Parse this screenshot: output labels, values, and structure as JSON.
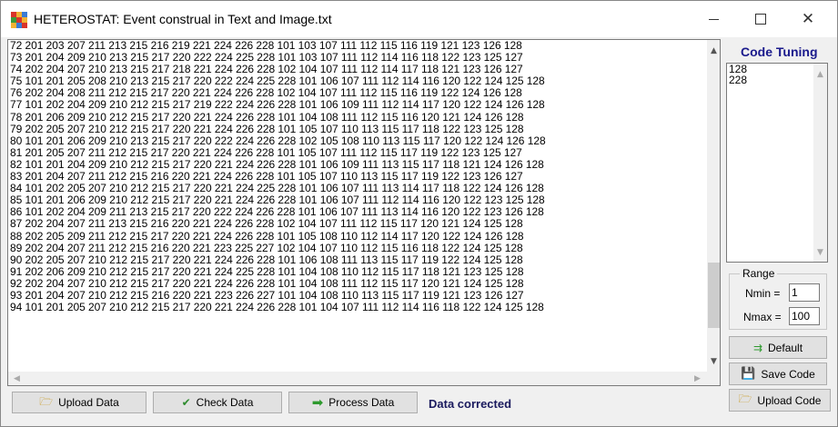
{
  "window": {
    "title": "HETEROSTAT: Event construal in Text and Image.txt",
    "icon": "heterostat-app-icon",
    "controls": [
      "minimize-icon",
      "maximize-icon",
      "close-icon"
    ]
  },
  "text_lines": [
    "72 201 203 207 211 213 215 216 219 221 224 226 228 101 103 107 111 112 115 116 119 121 123 126 128",
    "73 201 204 209 210 213 215 217 220 222 224 225 228 101 103 107 111 112 114 116 118 122 123 125 127",
    "74 202 204 207 210 213 215 217 218 221 224 226 228 102 104 107 111 112 114 117 118 121 123 126 127",
    "75 101 201 205 208 210 213 215 217 220 222 224 225 228 101 106 107 111 112 114 116 120 122 124 125 128",
    "76 202 204 208 211 212 215 217 220 221 224 226 228 102 104 107 111 112 115 116 119 122 124 126 128",
    "77 101 202 204 209 210 212 215 217 219 222 224 226 228 101 106 109 111 112 114 117 120 122 124 126 128",
    "78 201 206 209 210 212 215 217 220 221 224 226 228 101 104 108 111 112 115 116 120 121 124 126 128",
    "79 202 205 207 210 212 215 217 220 221 224 226 228 101 105 107 110 113 115 117 118 122 123 125 128",
    "80 101 201 206 209 210 213 215 217 220 222 224 226 228 102 105 108 110 113 115 117 120 122 124 126 128",
    "81 201 205 207 211 212 215 217 220 221 224 226 228 101 105 107 111 112 115 117 119 122 123 125 127",
    "82 101 201 204 209 210 212 215 217 220 221 224 226 228 101 106 109 111 113 115 117 118 121 124 126 128",
    "83 201 204 207 211 212 215 216 220 221 224 226 228 101 105 107 110 113 115 117 119 122 123 126 127",
    "84 101 202 205 207 210 212 215 217 220 221 224 225 228 101 106 107 111 113 114 117 118 122 124 126 128",
    "85 101 201 206 209 210 212 215 217 220 221 224 226 228 101 106 107 111 112 114 116 120 122 123 125 128",
    "86 101 202 204 209 211 213 215 217 220 222 224 226 228 101 106 107 111 113 114 116 120 122 123 126 128",
    "87 202 204 207 211 213 215 216 220 221 224 226 228 102 104 107 111 112 115 117 120 121 124 125 128",
    "88 202 205 209 211 212 215 217 220 221 224 226 228 101 105 108 110 112 114 117 120 122 124 126 128",
    "89 202 204 207 211 212 215 216 220 221 223 225 227 102 104 107 110 112 115 116 118 122 124 125 128",
    "90 202 205 207 210 212 215 217 220 221 224 226 228 101 106 108 111 113 115 117 119 122 124 125 128",
    "91 202 206 209 210 212 215 217 220 221 224 225 228 101 104 108 110 112 115 117 118 121 123 125 128",
    "92 202 204 207 210 212 215 217 220 221 224 226 228 101 104 108 111 112 115 117 120 121 124 125 128",
    "93 201 204 207 210 212 215 216 220 221 223 226 227 101 104 108 110 113 115 117 119 121 123 126 127",
    "94 101 201 205 207 210 212 215 217 220 221 224 226 228 101 104 107 111 112 114 116 118 122 124 125 128"
  ],
  "scrollbars": {
    "up_icon": "scroll-up-arrow-icon",
    "down_icon": "scroll-down-arrow-icon",
    "left_icon": "scroll-left-arrow-icon",
    "right_icon": "scroll-right-arrow-icon"
  },
  "bottom_bar": {
    "upload_data": "Upload Data",
    "check_data": "Check Data",
    "process_data": "Process Data",
    "status": "Data corrected"
  },
  "side_panel": {
    "title": "Code Tuning",
    "codes": [
      "128",
      "228"
    ],
    "range_label": "Range",
    "nmin_label": "Nmin =",
    "nmin_value": "1",
    "nmax_label": "Nmax =",
    "nmax_value": "100",
    "default_button": "Default",
    "save_code_button": "Save Code",
    "upload_code_button": "Upload Code"
  },
  "colors": {
    "status_text": "#1a1a5e",
    "panel_title": "#1a1a8c",
    "check_icon": "#2e8b2e",
    "process_arrow": "#2e9a2e",
    "folder_icon": "#e8b830"
  }
}
